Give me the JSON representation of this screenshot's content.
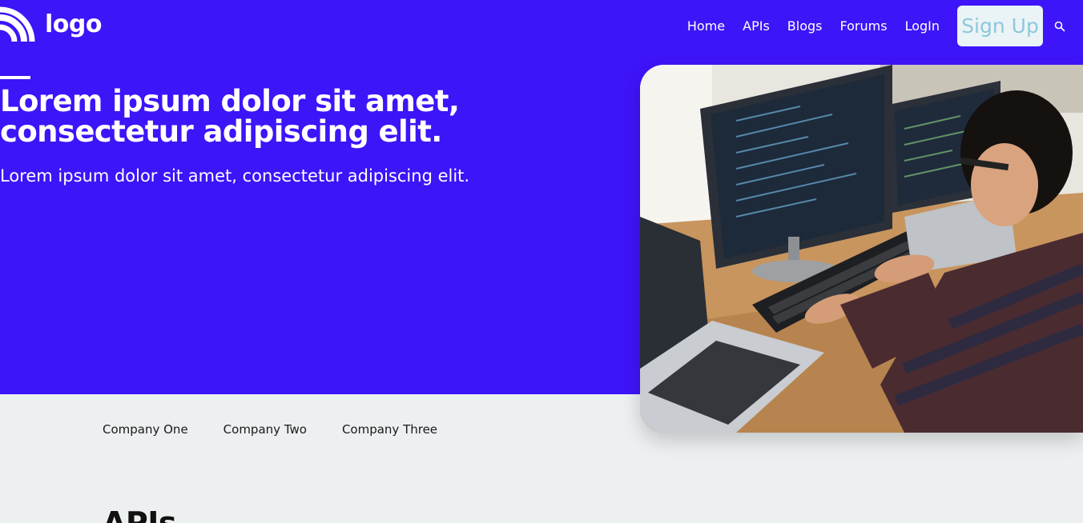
{
  "header": {
    "logo_text": "logo",
    "nav": [
      {
        "label": "Home"
      },
      {
        "label": "APIs"
      },
      {
        "label": "Blogs"
      },
      {
        "label": "Forums"
      },
      {
        "label": "LogIn"
      }
    ],
    "signup_label": "Sign Up",
    "search_icon": "search-icon"
  },
  "hero": {
    "title": "Lorem ipsum dolor sit amet, consectetur adipiscing elit.",
    "subtitle": "Lorem ipsum dolor sit amet, consectetur adipiscing elit."
  },
  "companies": [
    {
      "name": "Company One"
    },
    {
      "name": "Company Two"
    },
    {
      "name": "Company Three"
    }
  ],
  "section": {
    "heading": "APIs"
  },
  "colors": {
    "hero_bg": "#3e14f9",
    "page_bg": "#ecf0f0",
    "signup_bg": "#eaf4f6",
    "signup_text": "#8fc7dc"
  }
}
